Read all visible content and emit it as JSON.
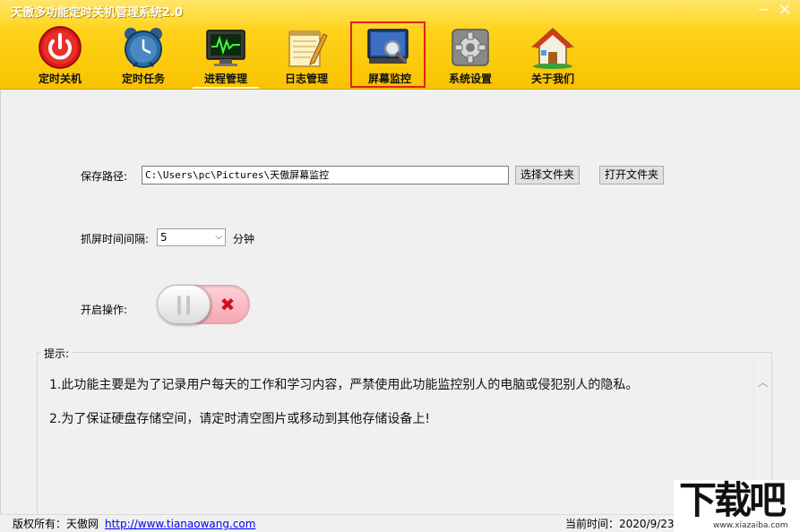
{
  "window": {
    "title": "天傲多功能定时关机管理系统2.0",
    "minimize": "─",
    "close": "×"
  },
  "toolbar": [
    {
      "id": "shutdown",
      "label": "定时关机",
      "icon": "power-icon"
    },
    {
      "id": "tasks",
      "label": "定时任务",
      "icon": "alarm-clock-icon"
    },
    {
      "id": "process",
      "label": "进程管理",
      "icon": "monitor-chart-icon"
    },
    {
      "id": "log",
      "label": "日志管理",
      "icon": "notepad-icon"
    },
    {
      "id": "screen",
      "label": "屏幕监控",
      "icon": "screen-magnifier-icon",
      "active": true
    },
    {
      "id": "settings",
      "label": "系统设置",
      "icon": "gear-icon"
    },
    {
      "id": "about",
      "label": "关于我们",
      "icon": "house-icon"
    }
  ],
  "form": {
    "path_label": "保存路径:",
    "path_value": "C:\\Users\\pc\\Pictures\\天傲屏幕监控",
    "choose_folder": "选择文件夹",
    "open_folder": "打开文件夹",
    "interval_label": "抓屏时间间隔:",
    "interval_value": "5",
    "interval_unit": "分钟",
    "enable_label": "开启操作:"
  },
  "tips": {
    "legend": "提示:",
    "line1": "1.此功能主要是为了记录用户每天的工作和学习内容，严禁使用此功能监控别人的电脑或侵犯别人的隐私。",
    "line2": "2.为了保证硬盘存储空间，请定时清空图片或移动到其他存储设备上!"
  },
  "status": {
    "copyright": "版权所有：天傲网",
    "link": "http://www.tianaowang.com",
    "time_label": "当前时间：2020/9/23"
  },
  "watermark": {
    "main": "下载吧",
    "sub": "www.xiazaiba.com"
  },
  "colors": {
    "header_yellow": "#ffd21a",
    "active_border": "#e02020",
    "toggle_off": "#f4a6b0"
  }
}
